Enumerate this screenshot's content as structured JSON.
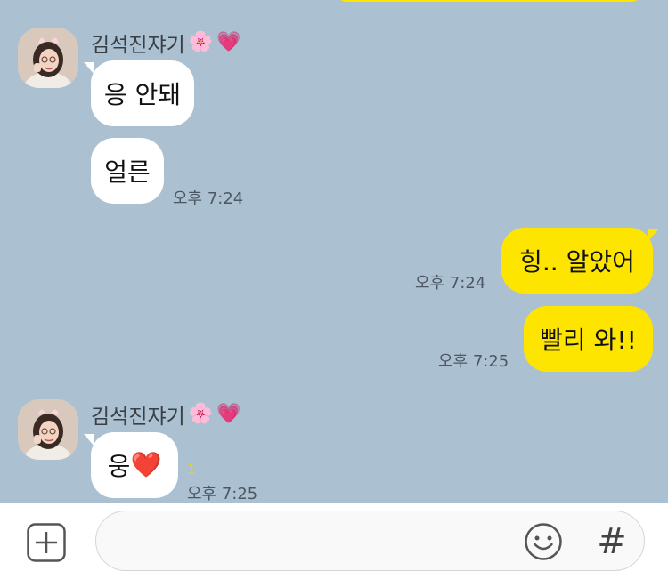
{
  "chat": {
    "messages": [
      {
        "sender": "김석진쟈기",
        "sender_emoji_1": "🌸",
        "sender_emoji_2": "💗",
        "bubbles": [
          "응 안돼",
          "얼른"
        ],
        "time": "오후 7:24"
      },
      {
        "outgoing_1": "힝.. 알았어",
        "time_1": "오후 7:24",
        "outgoing_2": "빨리 와!!",
        "time_2": "오후 7:25"
      },
      {
        "sender": "김석진쟈기",
        "sender_emoji_1": "🌸",
        "sender_emoji_2": "💗",
        "bubble_text": "웅",
        "bubble_emoji": "❤️",
        "unread": "1",
        "time": "오후 7:25"
      }
    ]
  },
  "input": {
    "plus_icon": "plus-square-icon",
    "emoji_icon": "smiley-icon",
    "hash_icon": "#",
    "value": "",
    "placeholder": ""
  },
  "colors": {
    "background": "#abc1d1",
    "incoming_bubble": "#ffffff",
    "outgoing_bubble": "#fee500",
    "unread": "#f1d200"
  }
}
